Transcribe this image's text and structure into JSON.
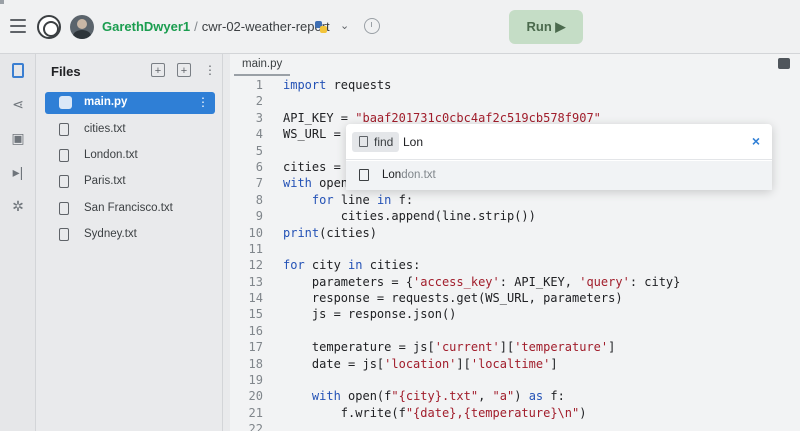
{
  "header": {
    "user": "GarethDwyer1",
    "separator": "/",
    "repl_name": "cwr-02-weather-report",
    "run_label": "Run ▶"
  },
  "rail": {
    "icons": [
      "files-icon",
      "version-control-icon",
      "packages-icon",
      "console-icon",
      "settings-icon"
    ]
  },
  "files": {
    "title": "Files",
    "items": [
      {
        "name": "main.py",
        "selected": true
      },
      {
        "name": "cities.txt"
      },
      {
        "name": "London.txt"
      },
      {
        "name": "Paris.txt"
      },
      {
        "name": "San Francisco.txt"
      },
      {
        "name": "Sydney.txt"
      }
    ]
  },
  "editor": {
    "tab": "main.py",
    "lines": [
      {
        "n": "1",
        "html": "<span class=\"kw\">import</span> requests"
      },
      {
        "n": "2",
        "html": ""
      },
      {
        "n": "3",
        "html": "API_KEY = <span class=\"str\">\"baaf201731c0cbc4af2c519cb578f907\"</span>"
      },
      {
        "n": "4",
        "html": "WS_URL = <span class=\"str\">\"</span>"
      },
      {
        "n": "5",
        "html": ""
      },
      {
        "n": "6",
        "html": "cities = ["
      },
      {
        "n": "7",
        "html": "<span class=\"kw\">with</span> open("
      },
      {
        "n": "8",
        "html": "    <span class=\"kw\">for</span> line <span class=\"kw\">in</span> f:"
      },
      {
        "n": "9",
        "html": "        cities.append(line.strip())"
      },
      {
        "n": "10",
        "html": "<span class=\"bi\">print</span>(cities)"
      },
      {
        "n": "11",
        "html": ""
      },
      {
        "n": "12",
        "html": "<span class=\"kw\">for</span> city <span class=\"kw\">in</span> cities:"
      },
      {
        "n": "13",
        "html": "    parameters = {<span class=\"str\">'access_key'</span>: API_KEY, <span class=\"str\">'query'</span>: city}"
      },
      {
        "n": "14",
        "html": "    response = requests.get(WS_URL, parameters)"
      },
      {
        "n": "15",
        "html": "    js = response.json()"
      },
      {
        "n": "16",
        "html": ""
      },
      {
        "n": "17",
        "html": "    temperature = js[<span class=\"str\">'current'</span>][<span class=\"str\">'temperature'</span>]"
      },
      {
        "n": "18",
        "html": "    date = js[<span class=\"str\">'location'</span>][<span class=\"str\">'localtime'</span>]"
      },
      {
        "n": "19",
        "html": ""
      },
      {
        "n": "20",
        "html": "    <span class=\"kw\">with</span> open(f<span class=\"str\">\"{city}.txt\"</span>, <span class=\"str\">\"a\"</span>) <span class=\"kw\">as</span> f:"
      },
      {
        "n": "21",
        "html": "        f.write(f<span class=\"str\">\"{date},{temperature}\\n\"</span>)"
      },
      {
        "n": "22",
        "html": ""
      }
    ]
  },
  "find": {
    "chip_label": "find",
    "query": "Lon",
    "close": "×",
    "result_match": "Lon",
    "result_rest": "don.txt"
  }
}
